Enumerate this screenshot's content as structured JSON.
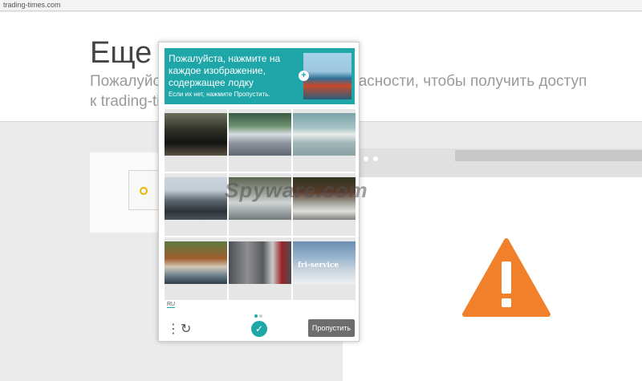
{
  "browser": {
    "url": "trading-times.com"
  },
  "page": {
    "title": "Еще о",
    "subtitle_line1": "Пожалуйст",
    "subtitle_line1_tail": "асности, чтобы получить доступ",
    "subtitle_line2": "к trading-ti"
  },
  "watermark": {
    "text": "Spyware.com"
  },
  "captcha": {
    "instruction": "Пожалуйста, нажмите на каждое изображение, содержащее лодку",
    "hint": "Если их нет, нажмите Пропустить.",
    "tiles": [
      {
        "label": ""
      },
      {
        "label": ""
      },
      {
        "label": ""
      },
      {
        "label": ""
      },
      {
        "label": ""
      },
      {
        "label": ""
      },
      {
        "label": ""
      },
      {
        "label": ""
      },
      {
        "label": "fri-service"
      }
    ],
    "language": "RU",
    "skip_label": "Пропустить",
    "icons": {
      "menu": "more-vertical-icon",
      "refresh": "refresh-icon",
      "logo": "hcaptcha-logo-icon",
      "plus": "plus-icon"
    }
  },
  "colors": {
    "accent": "#1fa6a9",
    "warning": "#f0812a",
    "skip_button": "#6d6d6d"
  }
}
